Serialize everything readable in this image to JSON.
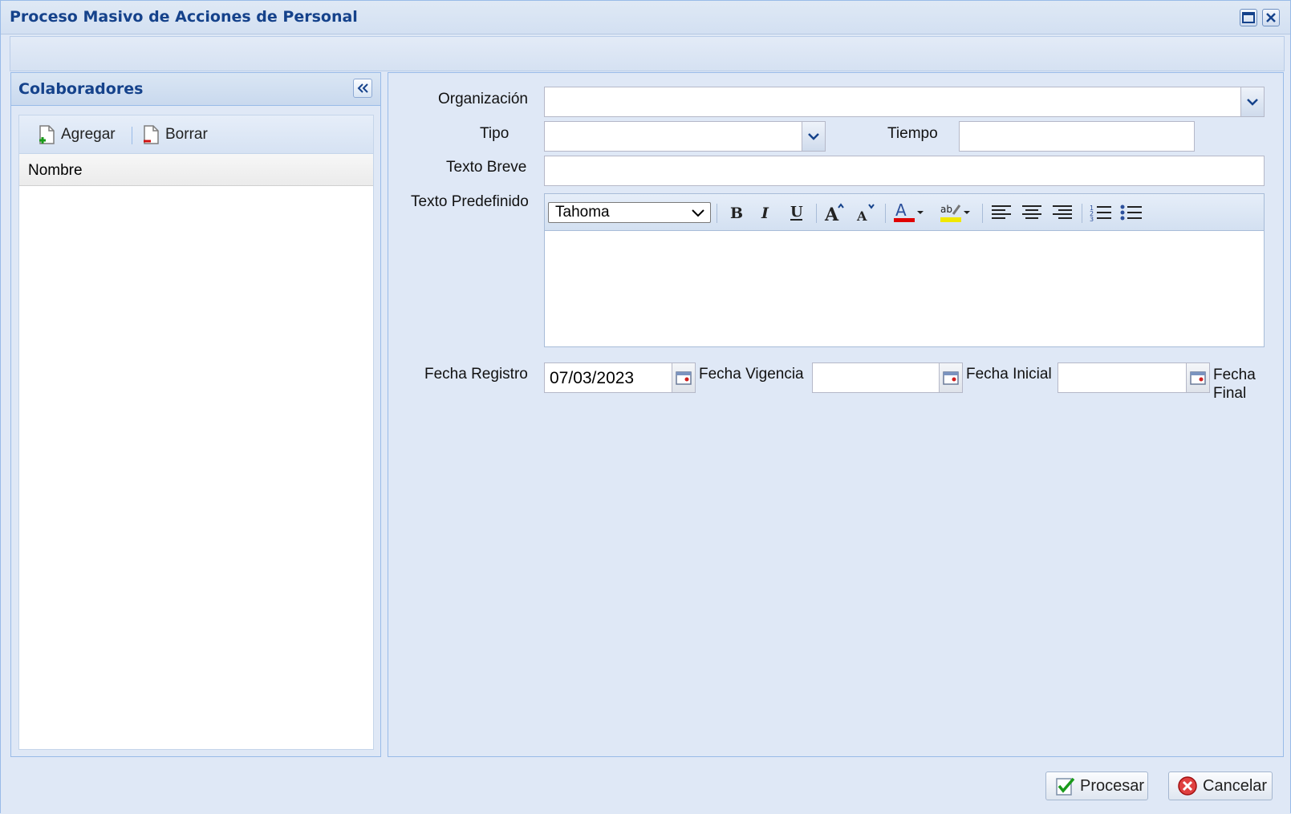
{
  "window": {
    "title": "Proceso Masivo de Acciones de Personal",
    "icons": [
      "maximize-icon",
      "close-icon"
    ]
  },
  "left_panel": {
    "title": "Colaboradores",
    "add_label": "Agregar",
    "delete_label": "Borrar",
    "column_header": "Nombre",
    "rows": []
  },
  "form": {
    "organizacion_label": "Organización",
    "organizacion_value": "",
    "tipo_label": "Tipo",
    "tipo_value": "",
    "tiempo_label": "Tiempo",
    "tiempo_value": "",
    "texto_breve_label": "Texto Breve",
    "texto_breve_value": "",
    "texto_predefinido_label": "Texto Predefinido",
    "editor_font": "Tahoma",
    "editor_content": "",
    "fecha_registro_label": "Fecha Registro",
    "fecha_registro_value": "07/03/2023",
    "fecha_vigencia_label": "Fecha Vigencia",
    "fecha_vigencia_value": "",
    "fecha_inicial_label": "Fecha Inicial",
    "fecha_inicial_value": "",
    "fecha_final_label_1": "Fecha",
    "fecha_final_label_2": "Final"
  },
  "footer": {
    "process_label": "Procesar",
    "cancel_label": "Cancelar"
  },
  "colors": {
    "title": "#15428b",
    "panel_bg": "#dfe8f6",
    "border": "#99bbe8",
    "font_color_bar": "#e00000",
    "highlight_bar": "#f0e800"
  }
}
